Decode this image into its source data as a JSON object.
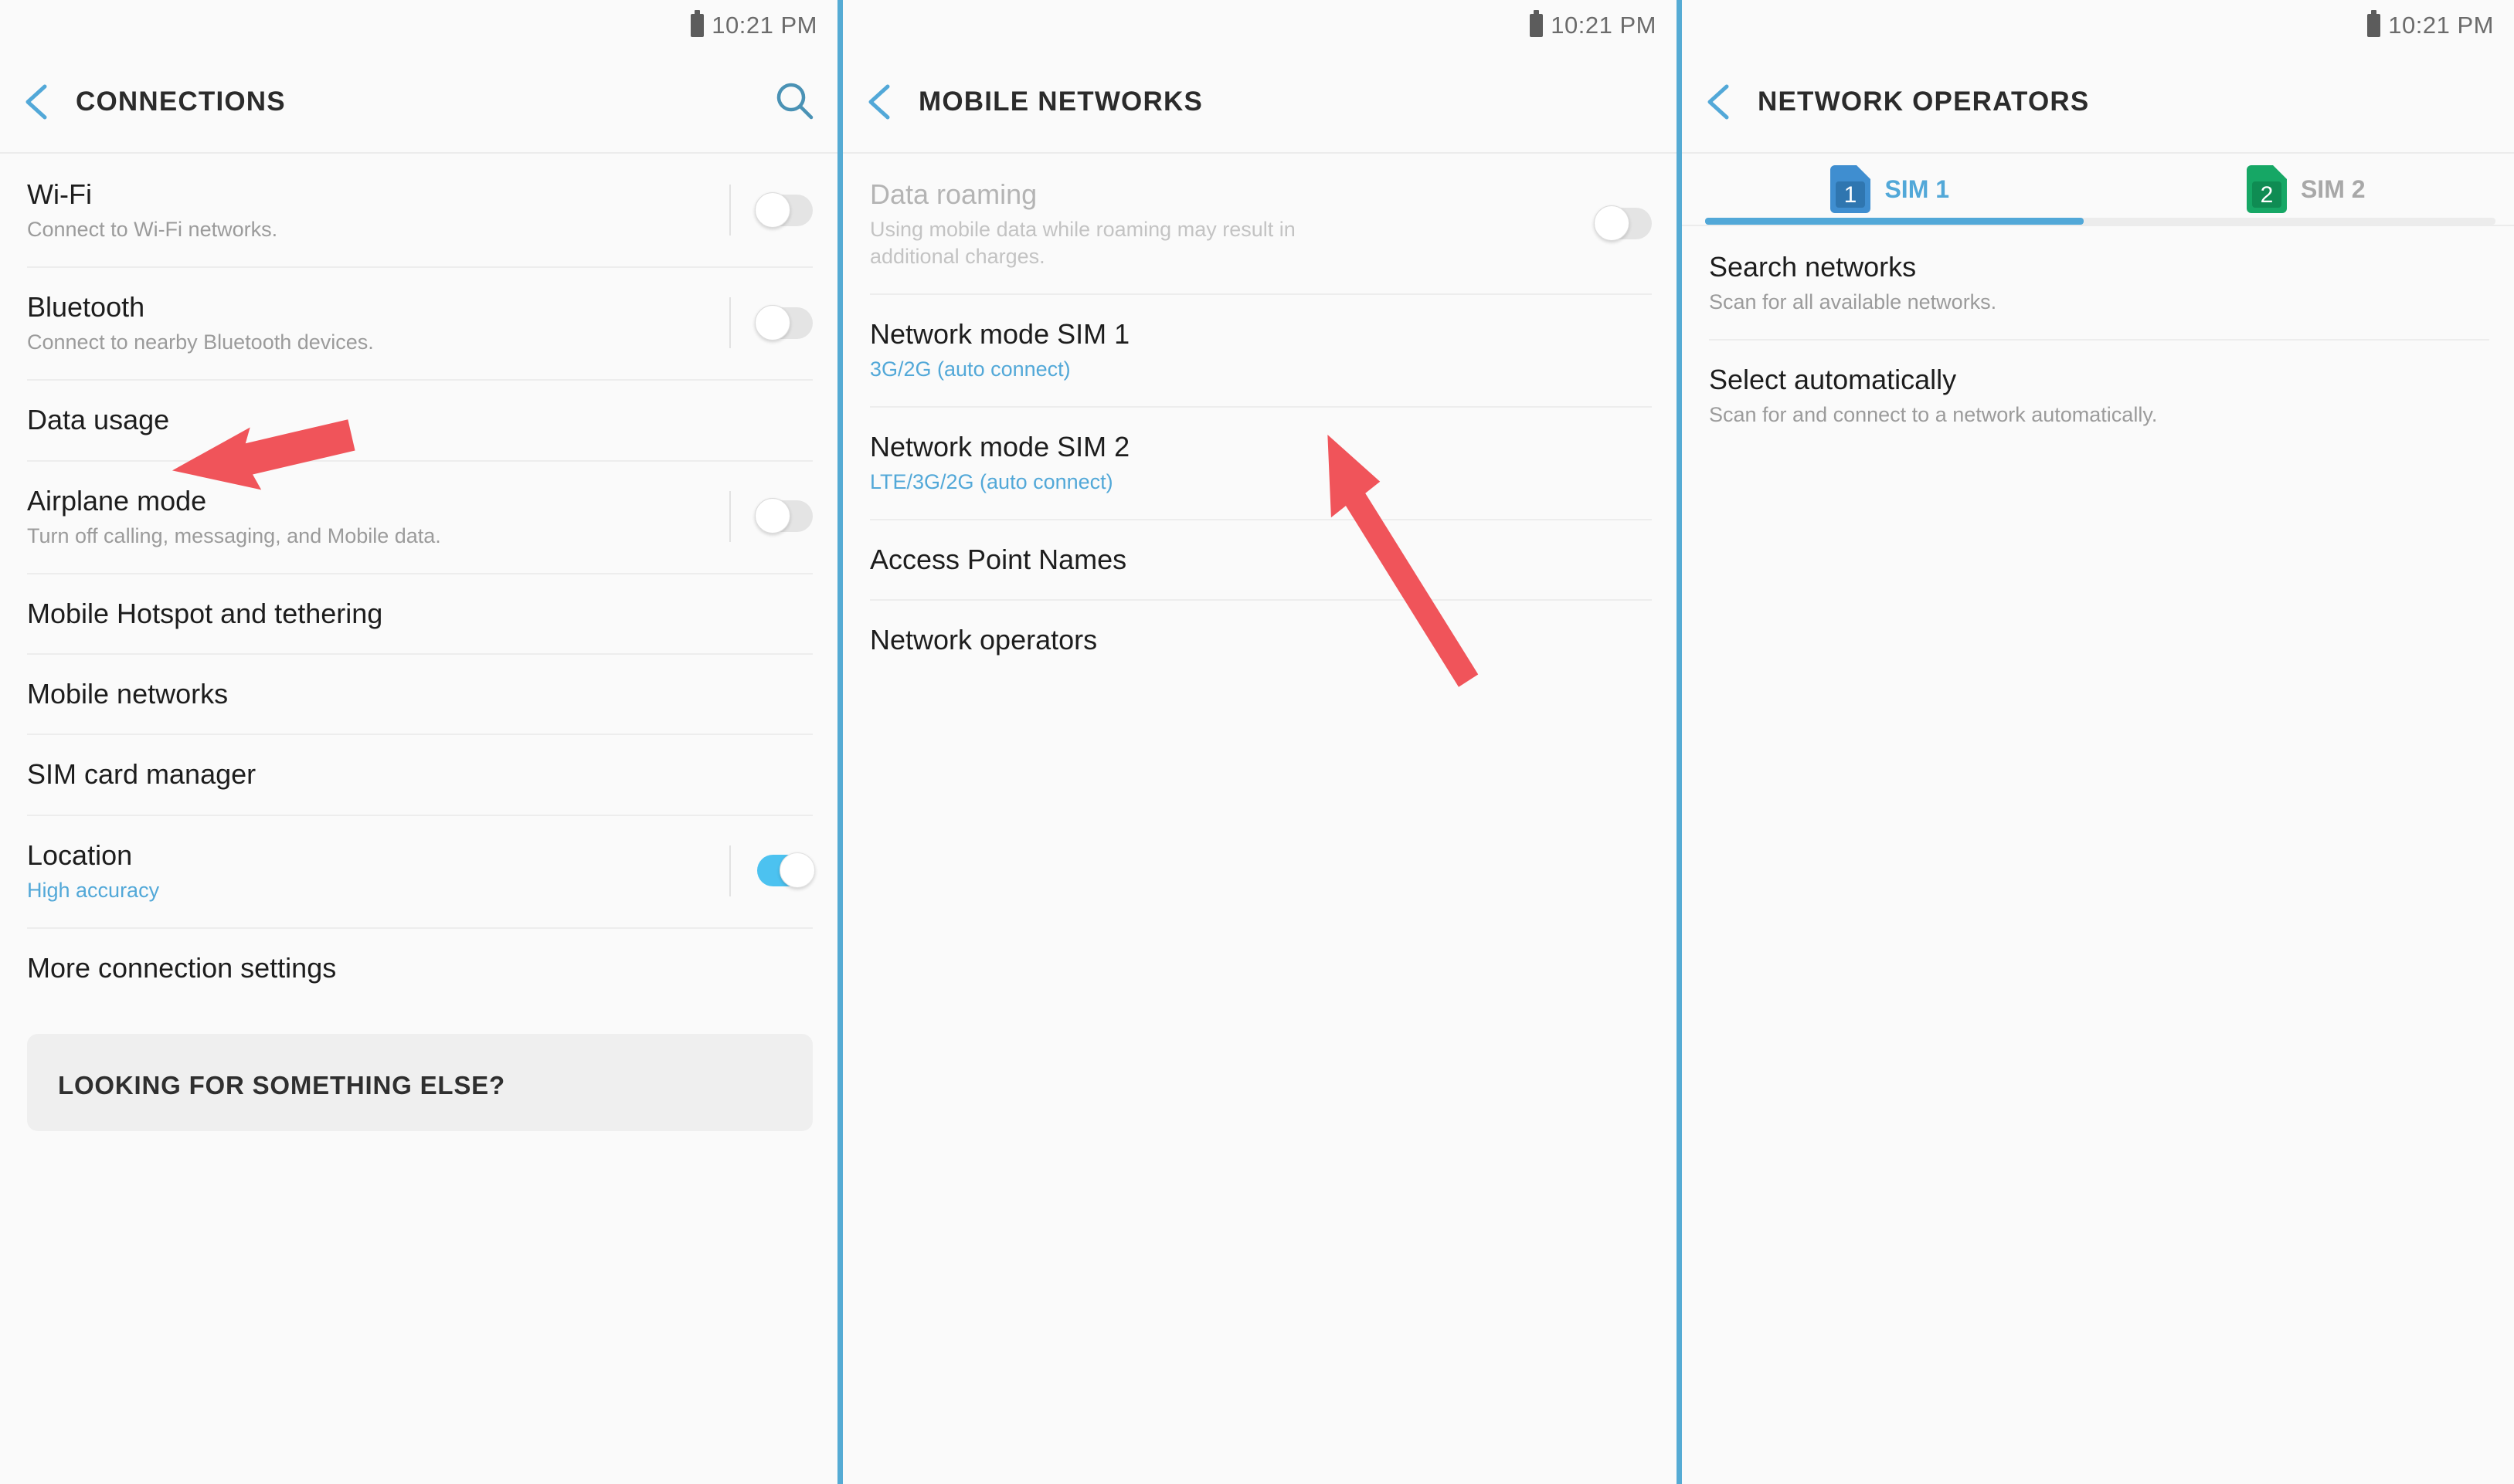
{
  "status": {
    "time": "10:21 PM",
    "battery_icon": "battery-icon"
  },
  "accent_colors": {
    "blue": "#52a8d8",
    "toggle_on": "#4cc2f0",
    "arrow_red": "#f0545a",
    "sim1_blue": "#3f8ed0",
    "sim2_green": "#16a765",
    "divider": "#ededed"
  },
  "panel1": {
    "title": "CONNECTIONS",
    "back_icon": "back-chevron-icon",
    "search_icon": "search-icon",
    "rows": [
      {
        "title": "Wi-Fi",
        "sub": "Connect to Wi-Fi networks.",
        "toggle": "off"
      },
      {
        "title": "Bluetooth",
        "sub": "Connect to nearby Bluetooth devices.",
        "toggle": "off"
      },
      {
        "title": "Data usage",
        "sub": "",
        "toggle": "none"
      },
      {
        "title": "Airplane mode",
        "sub": "Turn off calling, messaging, and Mobile data.",
        "toggle": "off"
      },
      {
        "title": "Mobile Hotspot and tethering",
        "sub": "",
        "toggle": "none"
      },
      {
        "title": "Mobile networks",
        "sub": "",
        "toggle": "none"
      },
      {
        "title": "SIM card manager",
        "sub": "",
        "toggle": "none"
      },
      {
        "title": "Location",
        "sub": "High accuracy",
        "toggle": "on"
      },
      {
        "title": "More connection settings",
        "sub": "",
        "toggle": "none"
      }
    ],
    "footer_card_title": "LOOKING FOR SOMETHING ELSE?",
    "annotation": "red-arrow-pointing-to-mobile-networks"
  },
  "panel2": {
    "title": "MOBILE NETWORKS",
    "back_icon": "back-chevron-icon",
    "rows": [
      {
        "title": "Data roaming",
        "sub": "Using mobile data while roaming may result in additional charges.",
        "toggle": "off",
        "disabled": true
      },
      {
        "title": "Network mode SIM 1",
        "sub": "3G/2G (auto connect)",
        "toggle": "none"
      },
      {
        "title": "Network mode SIM 2",
        "sub": "LTE/3G/2G (auto connect)",
        "toggle": "none"
      },
      {
        "title": "Access Point Names",
        "sub": "",
        "toggle": "none"
      },
      {
        "title": "Network operators",
        "sub": "",
        "toggle": "none"
      }
    ],
    "annotation": "red-arrow-pointing-to-network-operators"
  },
  "panel3": {
    "title": "NETWORK OPERATORS",
    "back_icon": "back-chevron-icon",
    "tabs": [
      {
        "label": "SIM 1",
        "badge": "1",
        "active": true,
        "icon": "sim-card-icon"
      },
      {
        "label": "SIM 2",
        "badge": "2",
        "active": false,
        "icon": "sim-card-icon"
      }
    ],
    "rows": [
      {
        "title": "Search networks",
        "sub": "Scan for all available networks.",
        "toggle": "none"
      },
      {
        "title": "Select automatically",
        "sub": "Scan for and connect to a network automatically.",
        "toggle": "none"
      }
    ]
  }
}
